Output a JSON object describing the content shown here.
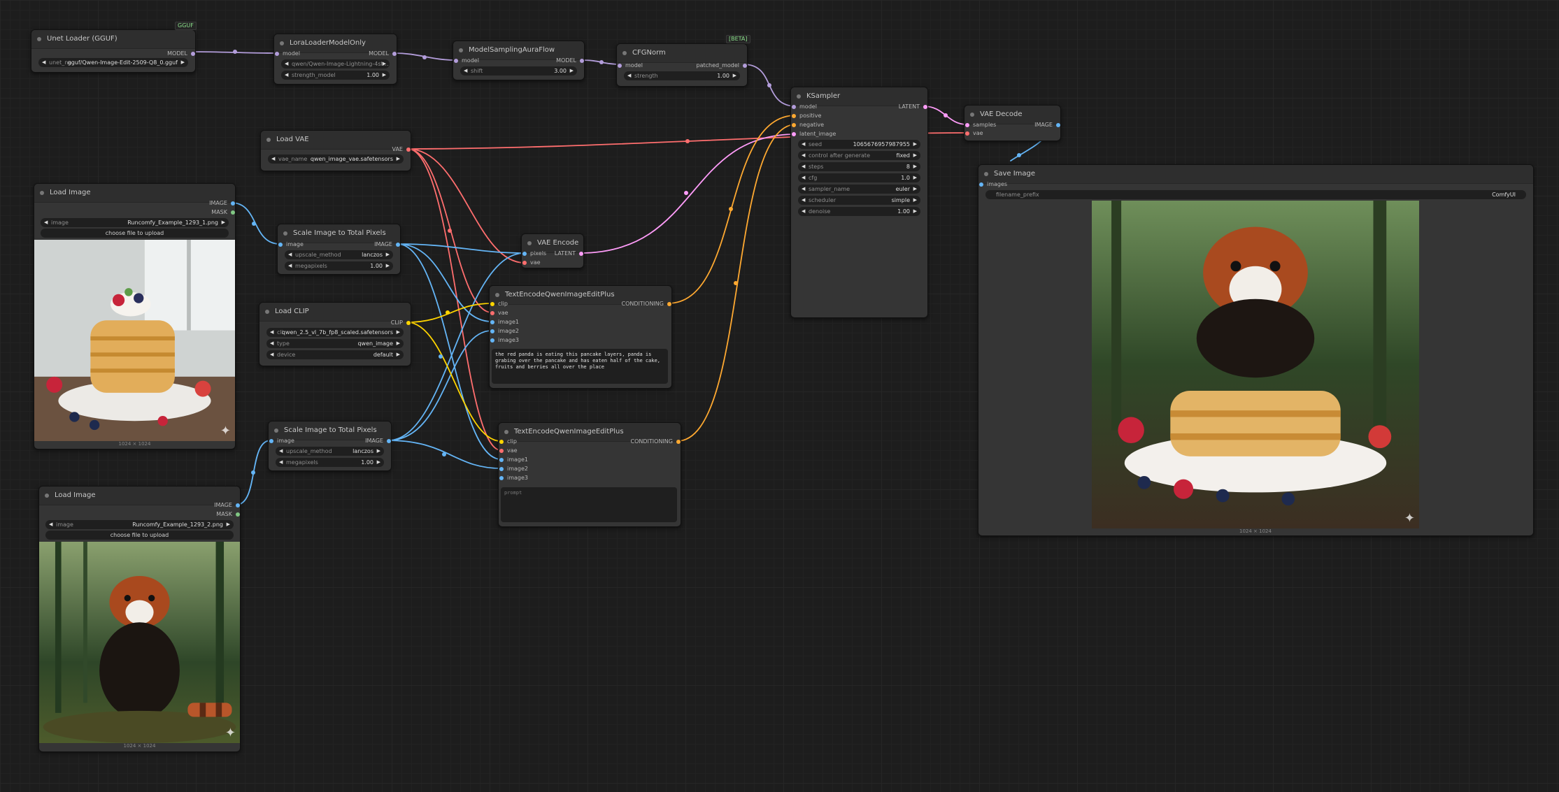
{
  "colors": {
    "model": "#b39ddb",
    "vae": "#ff6e6e",
    "image": "#64b5f6",
    "clip": "#ffd500",
    "conditioning": "#ffa931",
    "latent": "#ff9cf9",
    "mask": "#81c784"
  },
  "badges": {
    "gguf": "GGUF",
    "beta": "[BETA]"
  },
  "nodes": {
    "unet": {
      "title": "Unet Loader (GGUF)",
      "out_model": "MODEL",
      "w_label": "unet_na",
      "w_value": "gguf/Qwen-Image-Edit-2509-Q8_0.gguf"
    },
    "lora": {
      "title": "LoraLoaderModelOnly",
      "in_model": "model",
      "out_model": "MODEL",
      "w1_value": "qwen/Qwen-Image-Lightning-4st…",
      "w2_label": "strength_model",
      "w2_value": "1.00"
    },
    "msaf": {
      "title": "ModelSamplingAuraFlow",
      "in_model": "model",
      "out_model": "MODEL",
      "w_label": "shift",
      "w_value": "3.00"
    },
    "cfgnorm": {
      "title": "CFGNorm",
      "in_model": "model",
      "out": "patched_model",
      "w_label": "strength",
      "w_value": "1.00"
    },
    "ksampler": {
      "title": "KSampler",
      "in_model": "model",
      "in_pos": "positive",
      "in_neg": "negative",
      "in_latent": "latent_image",
      "out_latent": "LATENT",
      "widgets": [
        {
          "label": "seed",
          "value": "1065676957987955"
        },
        {
          "label": "control after generate",
          "value": "fixed"
        },
        {
          "label": "steps",
          "value": "8"
        },
        {
          "label": "cfg",
          "value": "1.0"
        },
        {
          "label": "sampler_name",
          "value": "euler"
        },
        {
          "label": "scheduler",
          "value": "simple"
        },
        {
          "label": "denoise",
          "value": "1.00"
        }
      ]
    },
    "vaedecode": {
      "title": "VAE Decode",
      "in_samples": "samples",
      "in_vae": "vae",
      "out_image": "IMAGE"
    },
    "save": {
      "title": "Save Image",
      "in_images": "images",
      "w_label": "filename_prefix",
      "w_value": "ComfyUI",
      "dims": "1024 × 1024"
    },
    "loadvae": {
      "title": "Load VAE",
      "out_vae": "VAE",
      "w_label": "vae_name",
      "w_value": "qwen_image_vae.safetensors"
    },
    "loadimg1": {
      "title": "Load Image",
      "out_image": "IMAGE",
      "out_mask": "MASK",
      "w_label": "image",
      "w_value": "Runcomfy_Example_1293_1.png",
      "button": "choose file to upload",
      "dims": "1024 × 1024"
    },
    "scale1": {
      "title": "Scale Image to Total Pixels",
      "in_image": "image",
      "out_image": "IMAGE",
      "w1_label": "upscale_method",
      "w1_value": "lanczos",
      "w2_label": "megapixels",
      "w2_value": "1.00"
    },
    "vaeencode": {
      "title": "VAE Encode",
      "in_pixels": "pixels",
      "in_vae": "vae",
      "out_latent": "LATENT"
    },
    "loadclip": {
      "title": "Load CLIP",
      "out_clip": "CLIP",
      "w1_label": "cli",
      "w1_value": "qwen_2.5_vl_7b_fp8_scaled.safetensors",
      "w2_label": "type",
      "w2_value": "qwen_image",
      "w3_label": "device",
      "w3_value": "default"
    },
    "te1": {
      "title": "TextEncodeQwenImageEditPlus",
      "in_clip": "clip",
      "in_vae": "vae",
      "in_img1": "image1",
      "in_img2": "image2",
      "in_img3": "image3",
      "out_cond": "CONDITIONING",
      "text": "the red panda is eating this pancake layers, panda is grabing over the pancake and has eaten half of the cake, fruits and berries all over the place"
    },
    "scale2": {
      "title": "Scale Image to Total Pixels",
      "in_image": "image",
      "out_image": "IMAGE",
      "w1_label": "upscale_method",
      "w1_value": "lanczos",
      "w2_label": "megapixels",
      "w2_value": "1.00"
    },
    "te2": {
      "title": "TextEncodeQwenImageEditPlus",
      "in_clip": "clip",
      "in_vae": "vae",
      "in_img1": "image1",
      "in_img2": "image2",
      "in_img3": "image3",
      "out_cond": "CONDITIONING",
      "placeholder": "prompt"
    },
    "loadimg2": {
      "title": "Load Image",
      "out_image": "IMAGE",
      "out_mask": "MASK",
      "w_label": "image",
      "w_value": "Runcomfy_Example_1293_2.png",
      "button": "choose file to upload",
      "dims": "1024 × 1024"
    }
  }
}
